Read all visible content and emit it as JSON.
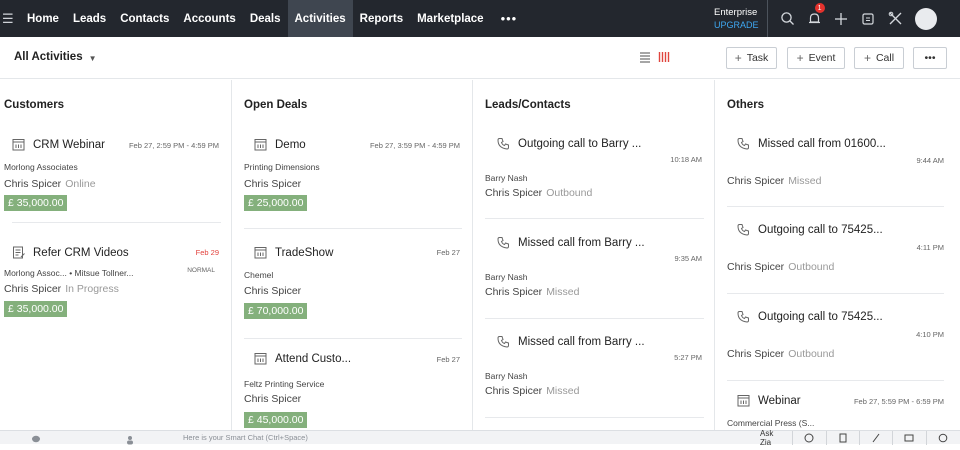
{
  "nav": {
    "items": [
      {
        "label": "Home",
        "active": false
      },
      {
        "label": "Leads",
        "active": false
      },
      {
        "label": "Contacts",
        "active": false
      },
      {
        "label": "Accounts",
        "active": false
      },
      {
        "label": "Deals",
        "active": false
      },
      {
        "label": "Activities",
        "active": true
      },
      {
        "label": "Reports",
        "active": false
      },
      {
        "label": "Marketplace",
        "active": false
      }
    ],
    "more": "•••",
    "edition": "Enterprise",
    "upgrade": "UPGRADE",
    "notification_count": "1",
    "icons": [
      "search-icon",
      "bell-icon",
      "plus-icon",
      "calendar-icon",
      "tools-icon"
    ]
  },
  "toolbar": {
    "view": "All Activities",
    "task": "Task",
    "event": "Event",
    "call": "Call",
    "more": "•••"
  },
  "columns": [
    {
      "title": "Customers",
      "cards": [
        {
          "icon": "calendar-icon",
          "title": "CRM Webinar",
          "time": "Feb 27, 2:59 PM - 4:59 PM",
          "time_red": false,
          "sub": "Morlong Associates",
          "owner": "Chris Spicer",
          "status": "Online",
          "amount": "£ 35,000.00"
        },
        {
          "icon": "task-icon",
          "title": "Refer CRM Videos",
          "time": "Feb 29",
          "time_red": true,
          "priority": "NORMAL",
          "sub": "Morlong Assoc... • Mitsue Tollner...",
          "owner": "Chris Spicer",
          "status": "In Progress",
          "amount": "£ 35,000.00"
        }
      ]
    },
    {
      "title": "Open Deals",
      "cards": [
        {
          "icon": "calendar-icon",
          "title": "Demo",
          "time": "Feb 27, 3:59 PM - 4:59 PM",
          "sub": "Printing Dimensions",
          "owner": "Chris Spicer",
          "amount": "£ 25,000.00"
        },
        {
          "icon": "calendar-icon",
          "title": "TradeShow",
          "time": "Feb 27",
          "sub": "Chemel",
          "owner": "Chris Spicer",
          "amount": "£ 70,000.00"
        },
        {
          "icon": "calendar-icon",
          "title": "Attend Custo...",
          "time": "Feb 27",
          "sub": "Feltz Printing Service",
          "owner": "Chris Spicer",
          "amount": "£ 45,000.00"
        }
      ]
    },
    {
      "title": "Leads/Contacts",
      "cards": [
        {
          "icon": "phone-icon",
          "title": "Outgoing call to Barry ...",
          "time": "10:18 AM",
          "sub": "Barry Nash",
          "owner": "Chris Spicer",
          "status": "Outbound"
        },
        {
          "icon": "phone-icon",
          "title": "Missed call from Barry ...",
          "time": "9:35 AM",
          "sub": "Barry Nash",
          "owner": "Chris Spicer",
          "status": "Missed"
        },
        {
          "icon": "phone-icon",
          "title": "Missed call from Barry ...",
          "time": "5:27 PM",
          "sub": "Barry Nash",
          "owner": "Chris Spicer",
          "status": "Missed"
        }
      ]
    },
    {
      "title": "Others",
      "cards": [
        {
          "icon": "phone-icon",
          "title": "Missed call from 01600...",
          "time": "9:44 AM",
          "owner": "Chris Spicer",
          "status": "Missed"
        },
        {
          "icon": "phone-icon",
          "title": "Outgoing call to 75425...",
          "time": "4:11 PM",
          "owner": "Chris Spicer",
          "status": "Outbound"
        },
        {
          "icon": "phone-icon",
          "title": "Outgoing call to 75425...",
          "time": "4:10 PM",
          "owner": "Chris Spicer",
          "status": "Outbound"
        },
        {
          "icon": "calendar-icon",
          "title": "Webinar",
          "time": "Feb 27, 5:59 PM - 6:59 PM",
          "sub": "Commercial Press (S..."
        }
      ]
    }
  ],
  "bottombar": {
    "chat_placeholder": "Here is your Smart Chat (Ctrl+Space)",
    "ask_zia": "Ask Zia"
  }
}
